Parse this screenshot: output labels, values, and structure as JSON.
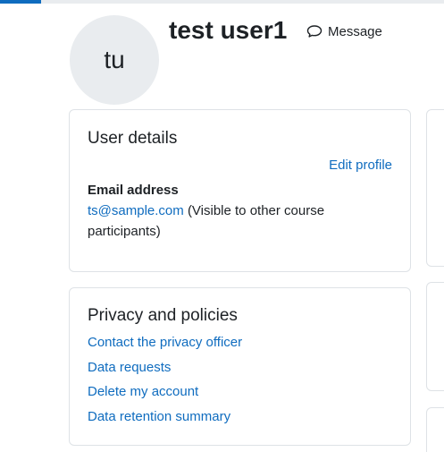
{
  "profile": {
    "avatar_initials": "tu",
    "name": "test user1",
    "message_label": "Message",
    "message_icon": "speech-bubble-icon"
  },
  "user_details": {
    "title": "User details",
    "edit_label": "Edit profile",
    "email_label": "Email address",
    "email_value": "ts@sample.com",
    "email_note": "(Visible to other course participants)"
  },
  "privacy": {
    "title": "Privacy and policies",
    "links": [
      "Contact the privacy officer",
      "Data requests",
      "Delete my account",
      "Data retention summary"
    ]
  },
  "colors": {
    "accent": "#0f6cbf",
    "avatar_bg": "#e9ecef",
    "border": "#dee2e6",
    "text": "#1d2125"
  }
}
